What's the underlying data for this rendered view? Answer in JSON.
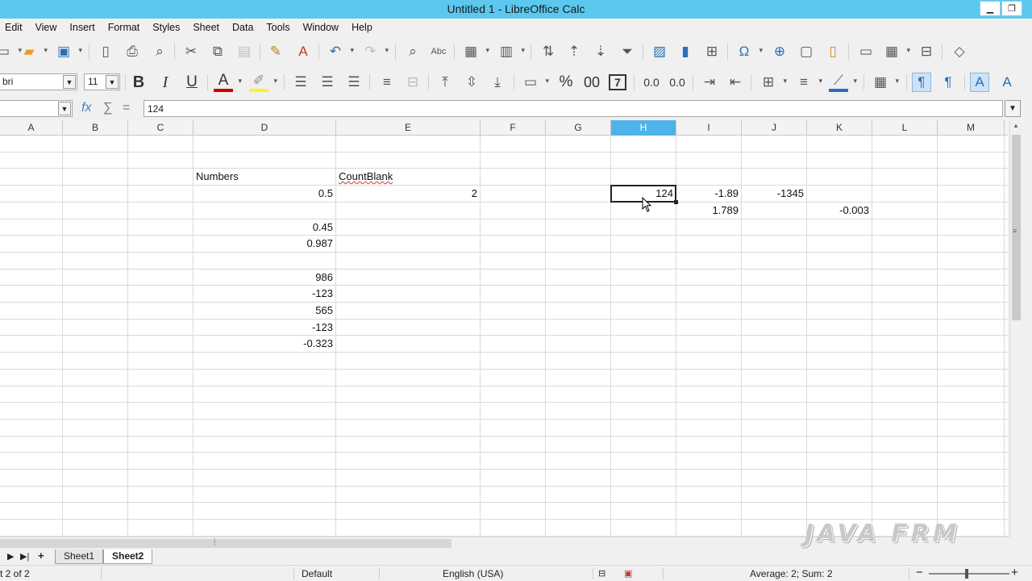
{
  "window": {
    "title": "Untitled 1 - LibreOffice Calc",
    "minimize_icon": "▁",
    "restore_icon": "❐"
  },
  "menu": {
    "items": [
      "Edit",
      "View",
      "Insert",
      "Format",
      "Styles",
      "Sheet",
      "Data",
      "Tools",
      "Window",
      "Help"
    ]
  },
  "format_toolbar": {
    "font_name": "bri",
    "font_size": "11",
    "bold": "B",
    "italic": "I",
    "underline": "U",
    "percent": "%",
    "number_format": "00",
    "date_format": "7",
    "add_decimal": "0.0",
    "remove_decimal": "0.0"
  },
  "formula_bar": {
    "name_box": "",
    "fx": "fx",
    "sum": "∑",
    "equals": "=",
    "content": "124"
  },
  "columns": [
    "A",
    "B",
    "C",
    "D",
    "E",
    "F",
    "G",
    "H",
    "I",
    "J",
    "K",
    "L",
    "M"
  ],
  "selected_column": "H",
  "cells": {
    "D3": "Numbers",
    "E3": "CountBlank",
    "D4": "0.5",
    "E4": "2",
    "H4": "124",
    "I4": "-1.89",
    "J4": "-1345",
    "I5": "1.789",
    "K5": "-0.003",
    "D6": "0.45",
    "D7": "0.987",
    "D9": "986",
    "D10": "-123",
    "D11": "565",
    "D12": "-123",
    "D13": "-0.323"
  },
  "sheets": {
    "tabs": [
      "Sheet1",
      "Sheet2"
    ],
    "active": "Sheet2"
  },
  "status": {
    "sheet_info": "t 2 of 2",
    "page_style": "Default",
    "language": "English (USA)",
    "summary": "Average: 2; Sum: 2",
    "zoom_minus": "−",
    "zoom_plus": "+"
  },
  "watermark": {
    "text": "JAVA FRM"
  }
}
